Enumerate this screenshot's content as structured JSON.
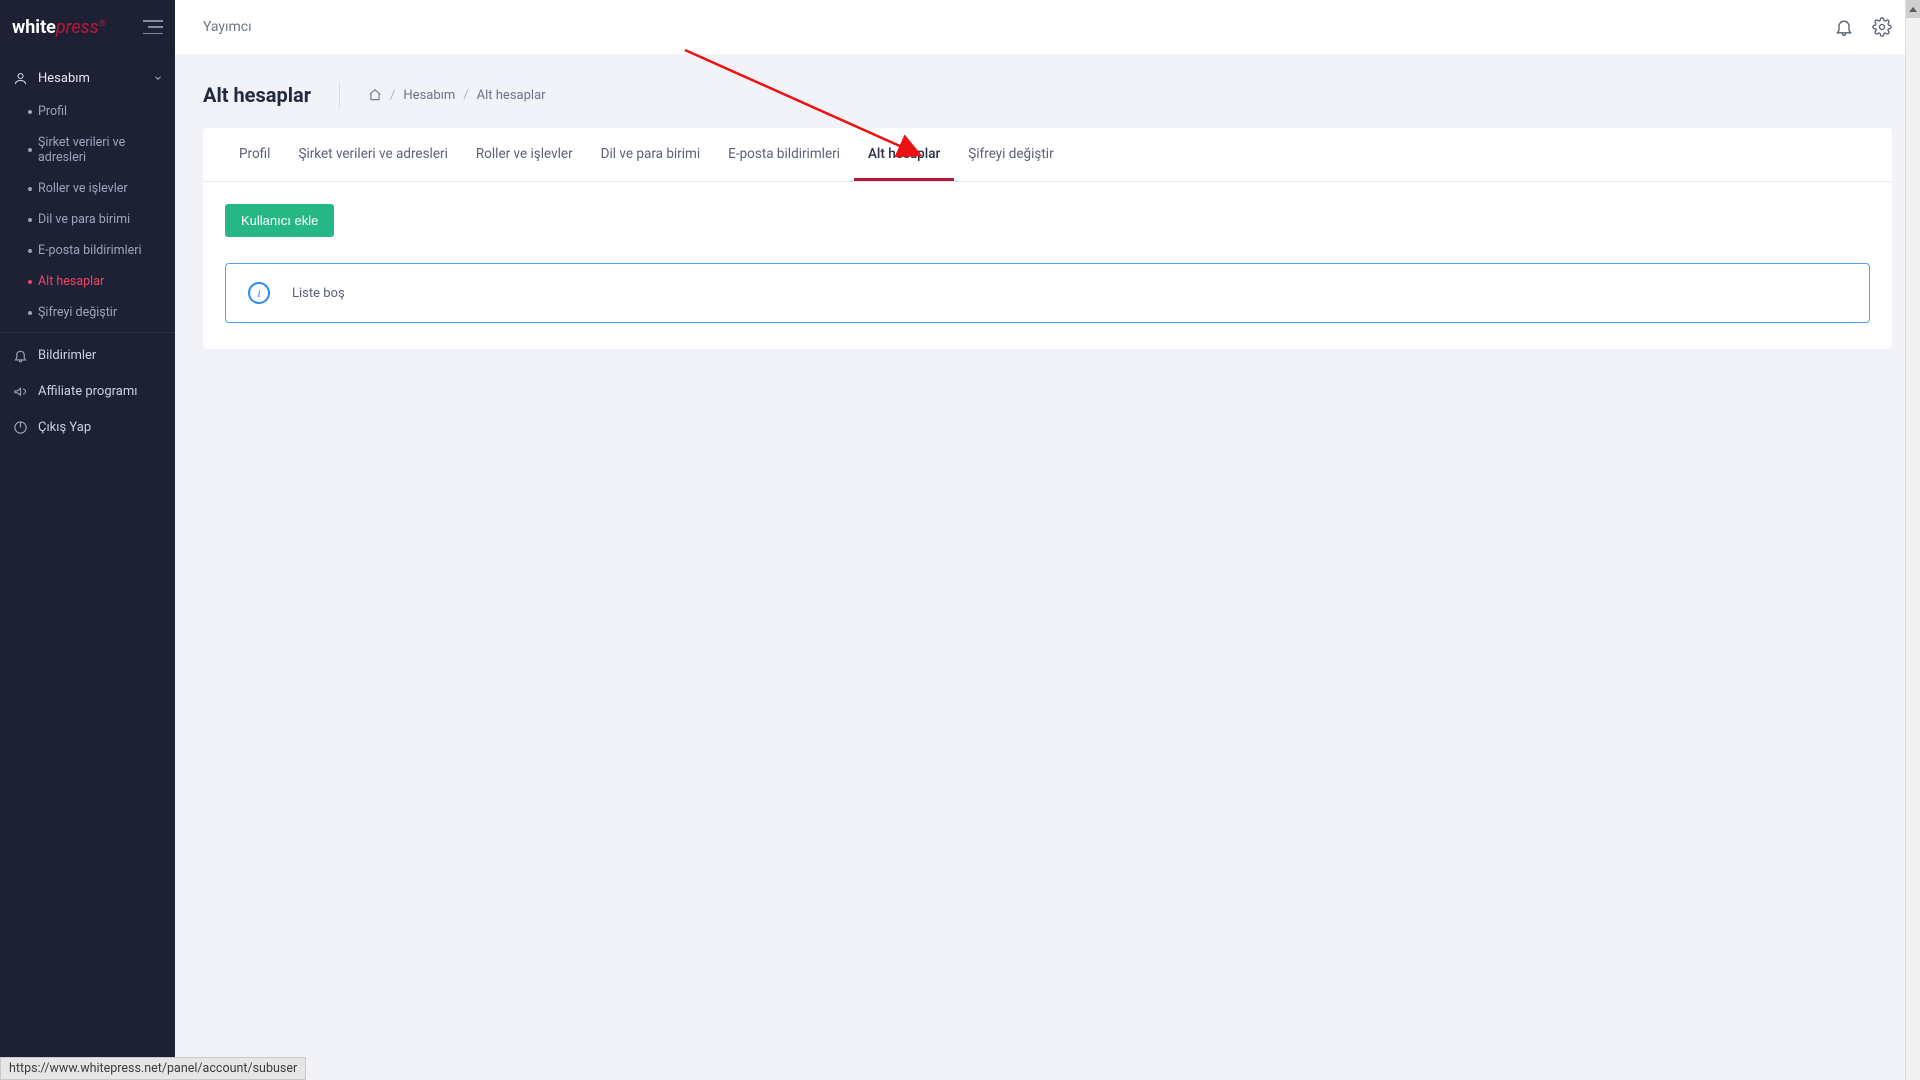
{
  "logo": {
    "white": "white",
    "press": "press"
  },
  "topbar": {
    "publisher_label": "Yayımcı"
  },
  "sidebar": {
    "account_label": "Hesabım",
    "sub": {
      "profile": "Profil",
      "company": "Şirket verileri ve adresleri",
      "roles": "Roller ve işlevler",
      "lang": "Dil ve para birimi",
      "email": "E-posta bildirimleri",
      "subaccounts": "Alt hesaplar",
      "password": "Şifreyi değiştir"
    },
    "notifications": "Bildirimler",
    "affiliate": "Affiliate programı",
    "logout": "Çıkış Yap"
  },
  "page": {
    "title": "Alt hesaplar",
    "breadcrumb": {
      "account": "Hesabım",
      "current": "Alt hesaplar"
    }
  },
  "tabs": {
    "profile": "Profil",
    "company": "Şirket verileri ve adresleri",
    "roles": "Roller ve işlevler",
    "lang": "Dil ve para birimi",
    "email": "E-posta bildirimleri",
    "subaccounts": "Alt hesaplar",
    "password": "Şifreyi değiştir"
  },
  "actions": {
    "add_user": "Kullanıcı ekle"
  },
  "alert": {
    "empty_list": "Liste boş"
  },
  "status_url": "https://www.whitepress.net/panel/account/subuser"
}
